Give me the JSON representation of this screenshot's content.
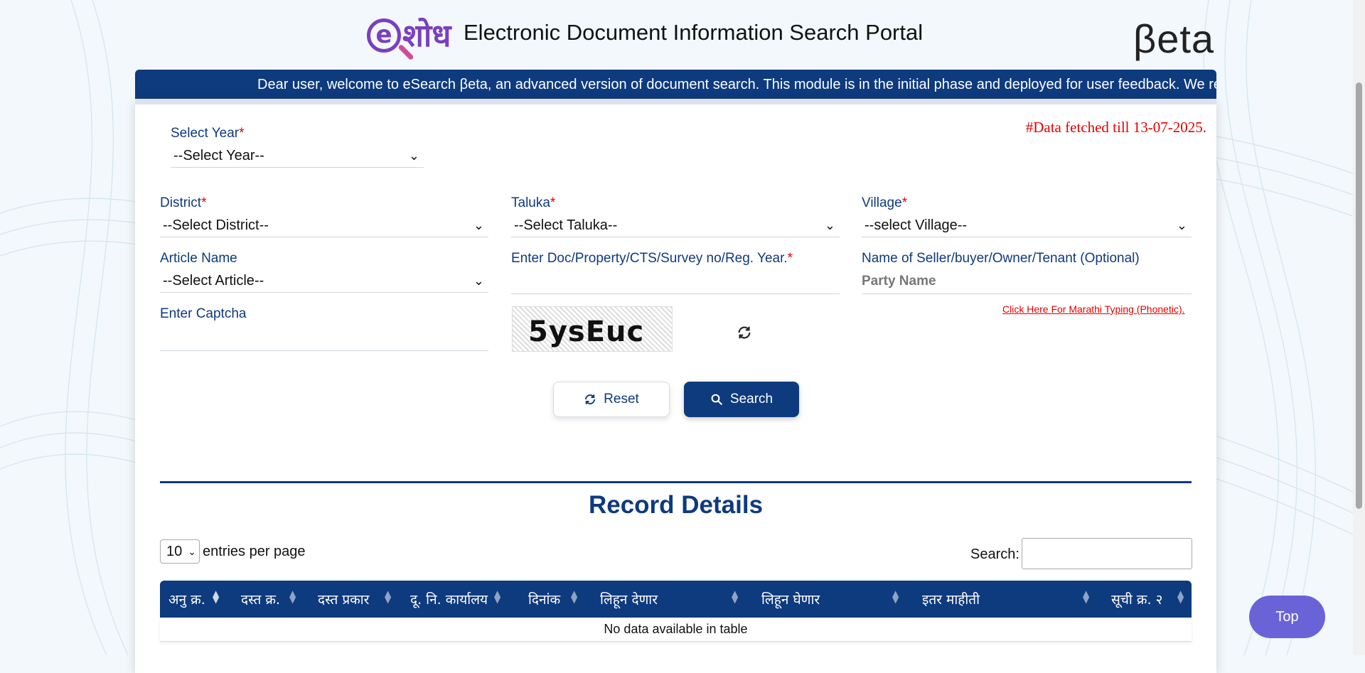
{
  "header": {
    "logo_letter": "e",
    "logo_word": "शोध",
    "title": "Electronic Document Information Search Portal",
    "beta_label": "βeta"
  },
  "marquee": {
    "text": "Dear user, welcome to eSearch βeta, an advanced version of document search. This module is in the initial phase and deployed for user feedback. We request"
  },
  "form": {
    "data_fetched": "#Data fetched till 13-07-2025.",
    "year": {
      "label": "Select Year",
      "required": "*",
      "value": "--Select Year--"
    },
    "district": {
      "label": "District",
      "required": "*",
      "value": "--Select District--"
    },
    "taluka": {
      "label": "Taluka",
      "required": "*",
      "value": "--Select Taluka--"
    },
    "village": {
      "label": "Village",
      "required": "*",
      "value": "--select Village--"
    },
    "article": {
      "label": "Article Name",
      "value": "--Select Article--"
    },
    "doc_no": {
      "label": "Enter Doc/Property/CTS/Survey no/Reg. Year.",
      "required": "*",
      "value": ""
    },
    "party": {
      "label": "Name of Seller/buyer/Owner/Tenant (Optional)",
      "placeholder": "Party Name"
    },
    "marathi_link": "Click Here For Marathi Typing (Phonetic).",
    "captcha_label": "Enter Captcha",
    "captcha_text": "5ysEuc",
    "reset_label": "Reset",
    "search_label": "Search"
  },
  "records": {
    "title": "Record Details",
    "entries_value": "10",
    "entries_label": "entries per page",
    "search_label": "Search:",
    "columns": [
      "अनु क्र.",
      "दस्त क्र.",
      "दस्त प्रकार",
      "दू. नि. कार्यालय",
      "दिनांक",
      "लिहून देणार",
      "लिहून घेणार",
      "इतर माहीती",
      "सूची क्र. २"
    ],
    "empty_text": "No data available in table"
  },
  "top_button": "Top",
  "colors": {
    "primary": "#0e3a7e",
    "accent_red": "#e60000",
    "top_button": "#6a63d8",
    "logo_purple": "#7b3fbf"
  }
}
